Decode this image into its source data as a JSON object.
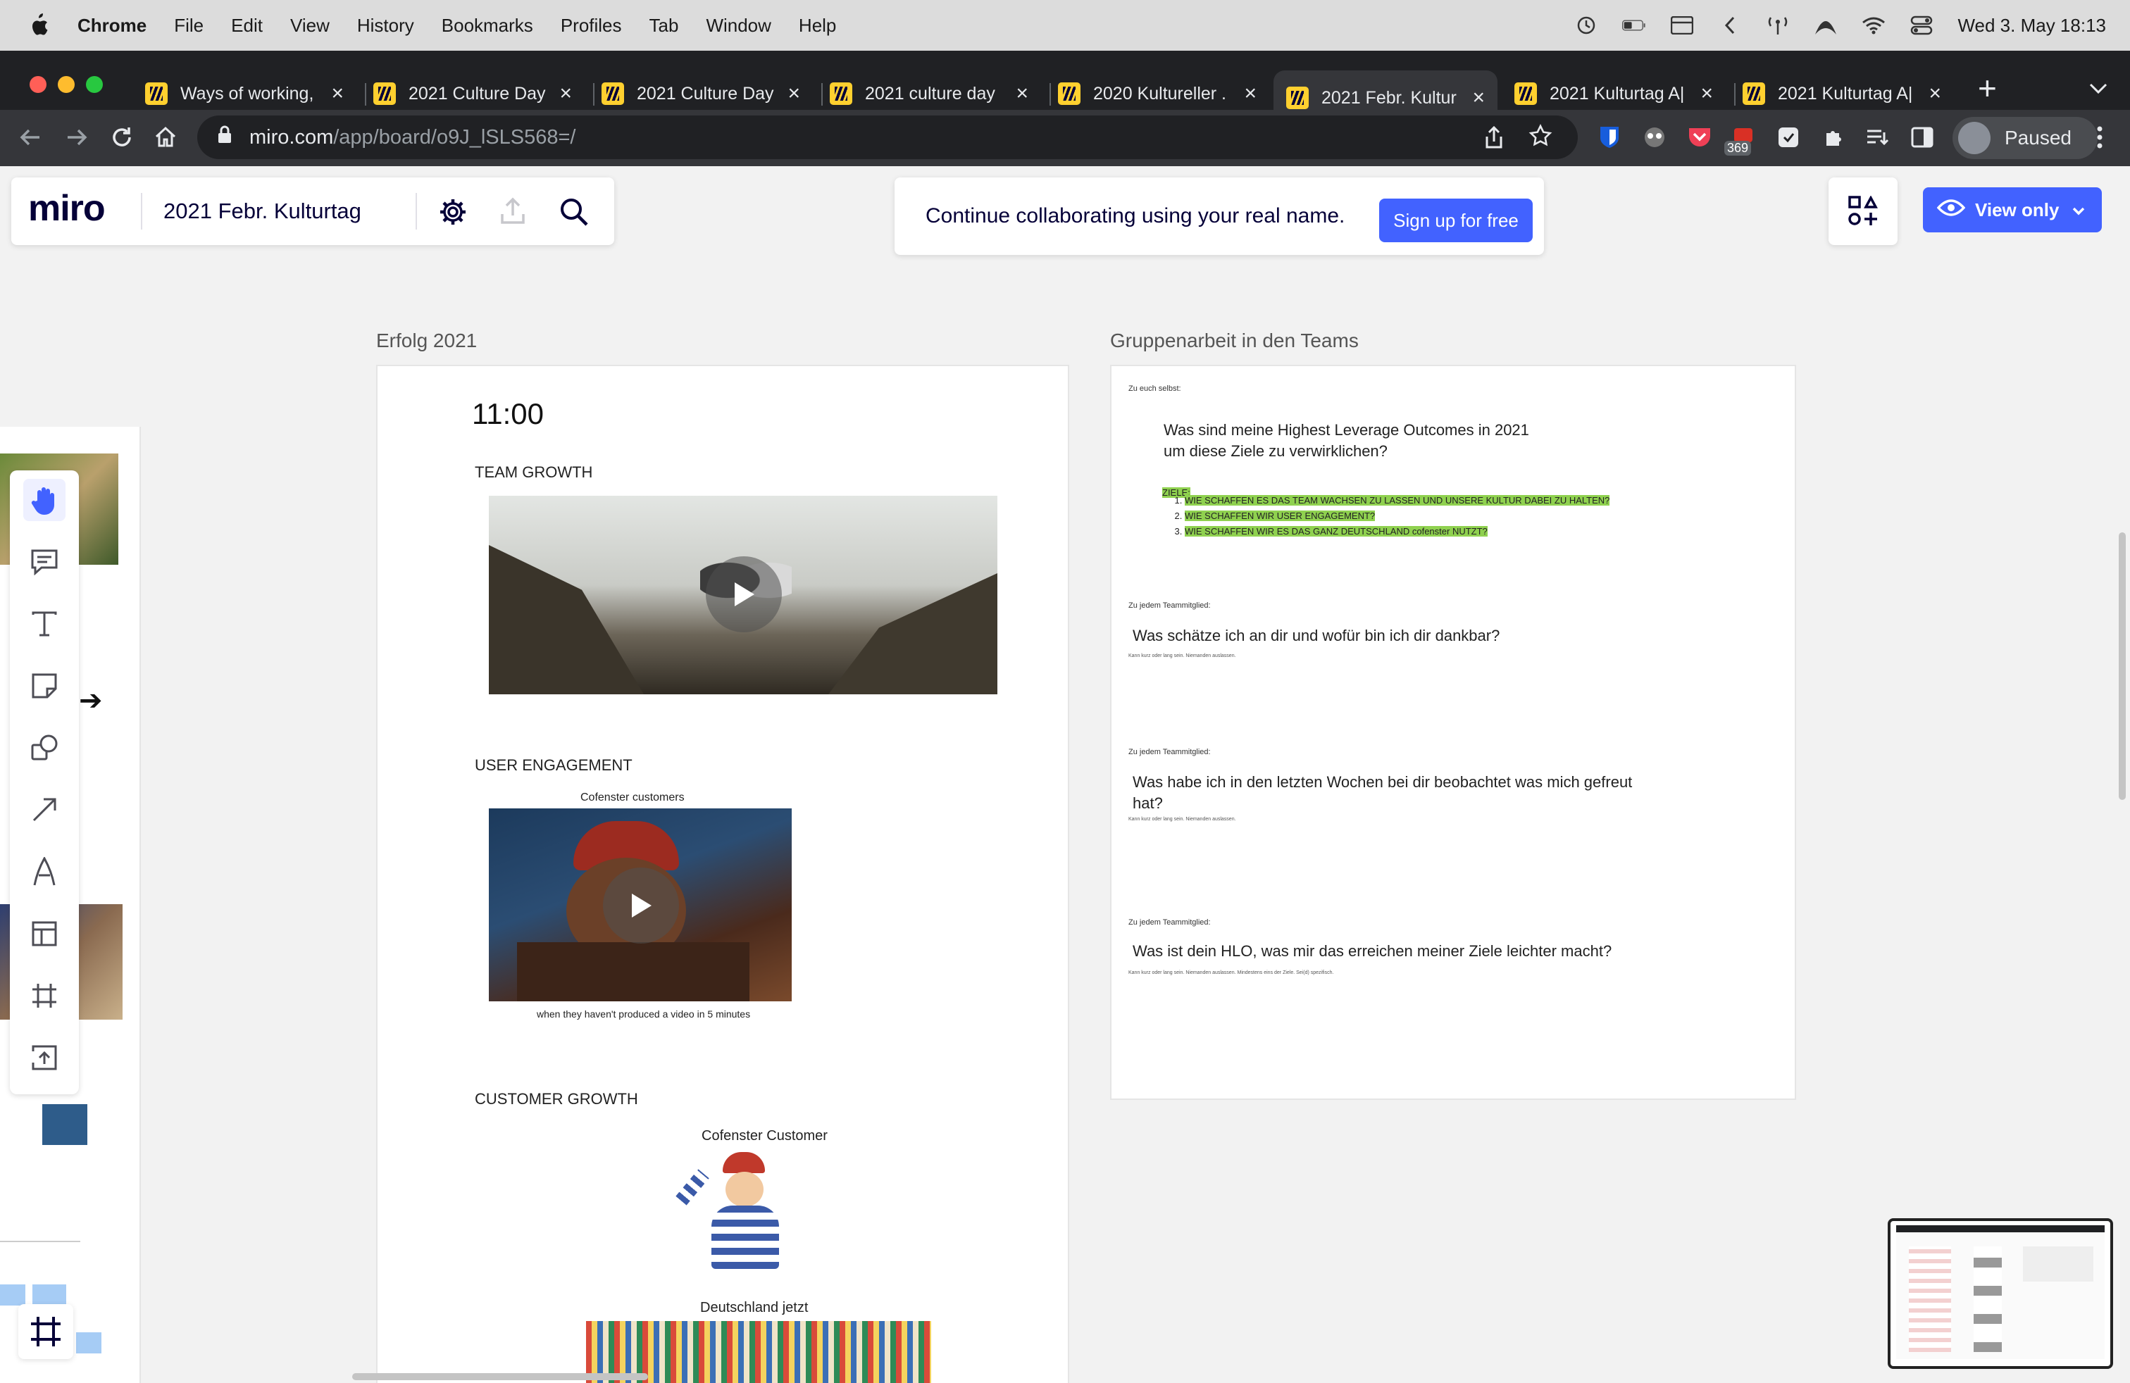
{
  "menubar": {
    "app": "Chrome",
    "items": [
      "File",
      "Edit",
      "View",
      "History",
      "Bookmarks",
      "Profiles",
      "Tab",
      "Window",
      "Help"
    ],
    "datetime": "Wed 3. May  18:13"
  },
  "tabs": [
    {
      "title": "Ways of working,"
    },
    {
      "title": "2021 Culture Day"
    },
    {
      "title": "2021 Culture Day"
    },
    {
      "title": "2021 culture day"
    },
    {
      "title": "2020 Kultureller ."
    },
    {
      "title": "2021 Febr. Kultur"
    },
    {
      "title": "2021 Kulturtag A|"
    },
    {
      "title": "2021 Kulturtag A|"
    }
  ],
  "address": {
    "host": "miro.com",
    "path": "/app/board/o9J_lSLS568=/"
  },
  "extensions": {
    "badge": "369"
  },
  "profile": {
    "label": "Paused"
  },
  "miro": {
    "logo": "miro",
    "board_title": "2021 Febr. Kulturtag",
    "banner_text": "Continue collaborating using your real name.",
    "signup_label": "Sign up for free",
    "view_only_label": "View only"
  },
  "left_frame": {
    "title": "Erfolg 2021",
    "time": "11:00",
    "team_growth": "TEAM GROWTH",
    "user_engagement": "USER ENGAGEMENT",
    "meme_top": "Cofenster customers",
    "meme_bottom": "when they haven't produced a video in 5 minutes",
    "customer_growth": "CUSTOMER GROWTH",
    "customer_caption": "Cofenster Customer",
    "deutschland_caption": "Deutschland jetzt"
  },
  "right_frame": {
    "title": "Gruppenarbeit in den Teams",
    "intro_label": "Zu euch selbst:",
    "q1_line1": "Was sind meine Highest Leverage Outcomes in 2021",
    "q1_line2": "um diese Ziele zu verwirklichen?",
    "ziele_label": "ZIELE:",
    "goals": [
      "WIE SCHAFFEN ES DAS TEAM WACHSEN ZU LASSEN UND UNSERE KULTUR DABEI ZU HALTEN?",
      "WIE SCHAFFEN WIR USER ENGAGEMENT?",
      "WIE SCHAFFEN WIR ES DAS GANZ DEUTSCHLAND cofenster NUTZT?"
    ],
    "member_label": "Zu jedem Teammitglied:",
    "q2": "Was schätze ich an dir und wofür bin ich dir dankbar?",
    "hint": "Kann kurz oder lang sein. Niemanden auslassen.",
    "q3_line1": "Was habe ich in den letzten Wochen bei dir beobachtet was mich gefreut",
    "q3_line2": "hat?",
    "q4": "Was ist dein HLO, was mir das erreichen meiner Ziele leichter macht?",
    "hint_long": "Kann kurz oder lang sein. Niemanden auslassen. Mindestens eins der Ziele. Sei(d) spezifisch."
  },
  "colors": {
    "miro_blue": "#4262ff",
    "highlight": "#8fd14f",
    "chrome_dark": "#202124"
  }
}
